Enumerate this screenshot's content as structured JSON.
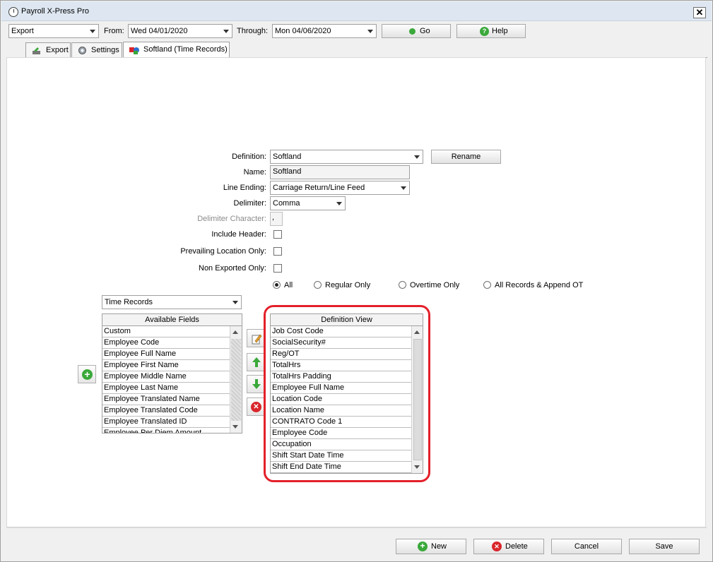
{
  "window": {
    "title": "Payroll X-Press Pro"
  },
  "toolbar": {
    "mode": "Export",
    "from_label": "From:",
    "from_date": "Wed 04/01/2020",
    "through_label": "Through:",
    "through_date": "Mon 04/06/2020",
    "go_label": "Go",
    "help_label": "Help"
  },
  "tabs": [
    {
      "label": "Export"
    },
    {
      "label": "Settings"
    },
    {
      "label": "Softland (Time Records)"
    }
  ],
  "form": {
    "definition_label": "Definition:",
    "definition_value": "Softland",
    "rename_label": "Rename",
    "name_label": "Name:",
    "name_value": "Softland",
    "line_ending_label": "Line Ending:",
    "line_ending_value": "Carriage Return/Line Feed",
    "delimiter_label": "Delimiter:",
    "delimiter_value": "Comma",
    "delimiter_char_label": "Delimiter Character:",
    "delimiter_char_value": ",",
    "include_header_label": "Include Header:",
    "prevailing_label": "Prevailing Location Only:",
    "non_exported_label": "Non Exported Only:",
    "radios": [
      "All",
      "Regular Only",
      "Overtime Only",
      "All Records & Append OT"
    ]
  },
  "available": {
    "source": "Time Records",
    "header": "Available Fields",
    "items": [
      "Custom",
      "Employee Code",
      "Employee Full Name",
      "Employee First Name",
      "Employee Middle Name",
      "Employee Last Name",
      "Employee Translated Name",
      "Employee Translated Code",
      "Employee Translated ID",
      "Employee Per Diem Amount"
    ]
  },
  "definition_view": {
    "header": "Definition View",
    "items": [
      "Job Cost Code",
      "SocialSecurity#",
      "Reg/OT",
      "TotalHrs",
      "TotalHrs Padding",
      "Employee Full Name",
      "Location Code",
      "Location Name",
      "CONTRATO Code 1",
      "Employee Code",
      "Occupation",
      "Shift Start Date Time",
      "Shift End Date Time"
    ]
  },
  "footer": {
    "new_label": "New",
    "delete_label": "Delete",
    "cancel_label": "Cancel",
    "save_label": "Save"
  },
  "colors": {
    "highlight": "#e3202a",
    "green": "#3aa83a",
    "red": "#d9262b"
  }
}
